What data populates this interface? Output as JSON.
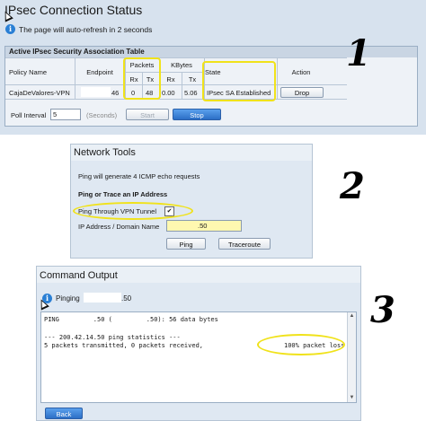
{
  "ipsec": {
    "title": "IPsec Connection Status",
    "refresh_note": "The page will auto-refresh in 2 seconds",
    "info_icon": "info-icon",
    "table_caption": "Active IPsec Security Association Table",
    "columns": {
      "policy_name": "Policy Name",
      "endpoint": "Endpoint",
      "packets": "Packets",
      "packets_rx": "Rx",
      "packets_tx": "Tx",
      "kbytes": "KBytes",
      "kbytes_rx": "Rx",
      "kbytes_tx": "Tx",
      "state": "State",
      "action": "Action"
    },
    "row": {
      "policy_name": "CajaDeValores-VPN",
      "endpoint": "46",
      "packets_rx": "0",
      "packets_tx": "48",
      "kbytes_rx": "0.00",
      "kbytes_tx": "5.06",
      "state": "IPsec SA Established",
      "drop_label": "Drop"
    },
    "poll_label": "Poll Interval",
    "poll_value": "5",
    "poll_unit": "(Seconds)",
    "start_label": "Start",
    "stop_label": "Stop",
    "step": "1",
    "highlight_color": "#f0e21a"
  },
  "network_tools": {
    "title": "Network Tools",
    "ping_note": "Ping will generate 4 ICMP echo requests",
    "section_title": "Ping or Trace an IP Address",
    "vpn_checkbox_label": "Ping Through VPN Tunnel",
    "vpn_checked": "✔",
    "ip_label": "IP Address / Domain Name",
    "ip_value": ".50",
    "ping_label": "Ping",
    "traceroute_label": "Traceroute",
    "step": "2"
  },
  "command_output": {
    "title": "Command Output",
    "pinging_label": "Pinging",
    "pinging_suffix": ".50",
    "lines": [
      "PING         .50 (         .50): 56 data bytes",
      "",
      "--- 200.42.14.50 ping statistics ---",
      "5 packets transmitted, 0 packets received,"
    ],
    "packet_loss": "100% packet loss",
    "back_label": "Back",
    "step": "3"
  }
}
